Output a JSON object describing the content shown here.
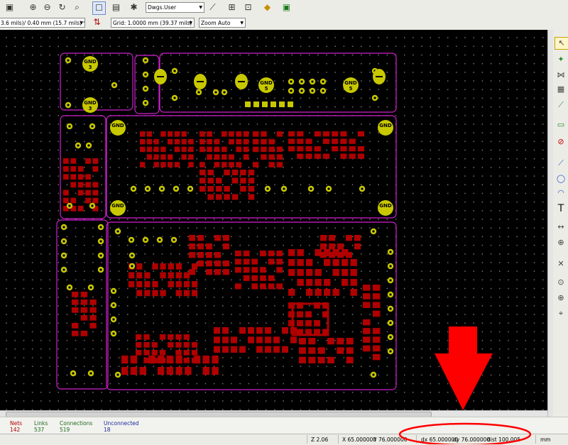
{
  "toolbar": {
    "layer_select": "Dwgs.User"
  },
  "toolbar2": {
    "track_width": "3.6 mils)/ 0.40 mm (15.7 mils) *",
    "grid": "Grid: 1.0000 mm (39.37 mils)",
    "zoom": "Zoom Auto"
  },
  "board": {
    "labels": {
      "gnd": "GND",
      "num3": "3",
      "num5": "5"
    }
  },
  "messages": {
    "nets_label": "Nets",
    "nets_value": "142",
    "links_label": "Links",
    "links_value": "537",
    "connections_label": "Connections",
    "connections_value": "519",
    "unconnected_label": "Unconnected",
    "unconnected_value": "18"
  },
  "status": {
    "zoom": "Z 2.06",
    "x": "X 65.000000",
    "y": "Y 76.000000",
    "dx": "dx 65.000000",
    "dy": "dy 76.000000",
    "dist": "dist 100.005",
    "units": "mm"
  },
  "colors": {
    "outline": "#d020d0",
    "pad_yellow": "#c8c800",
    "smd_red": "#b00000",
    "highlight": "#ff0000"
  }
}
